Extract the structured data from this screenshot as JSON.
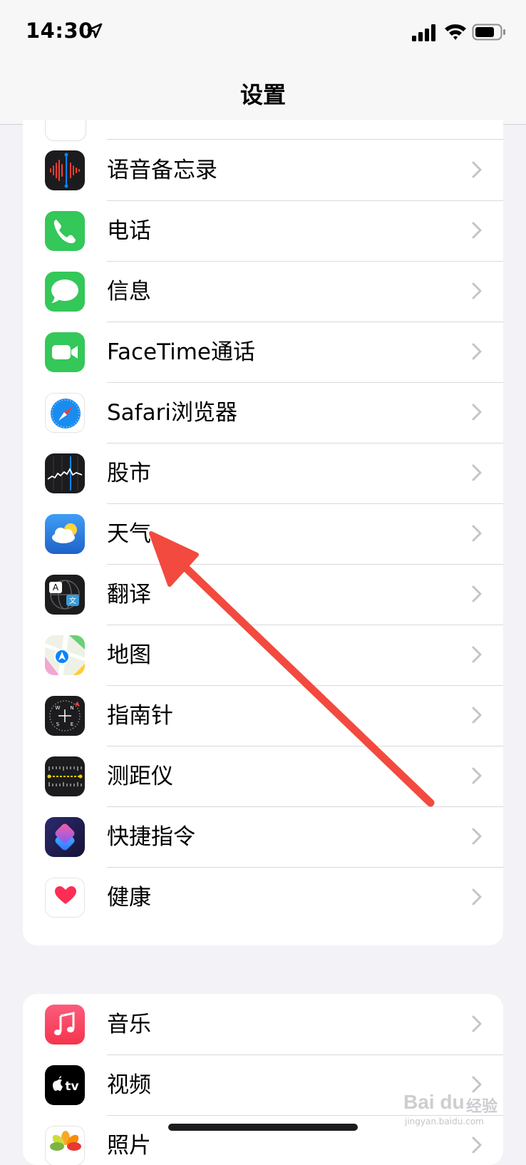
{
  "status_bar": {
    "time": "14:30",
    "icons": [
      "location-arrow-icon",
      "cellular-signal-icon",
      "wifi-icon",
      "battery-icon"
    ]
  },
  "nav": {
    "title": "设置"
  },
  "colors": {
    "background": "#f2f2f7",
    "cell": "#ffffff",
    "separator": "#d9d9de",
    "chevron": "#c4c4c7",
    "annotation_arrow": "#f24a3f"
  },
  "group_a": {
    "items": [
      {
        "label": "语音备忘录",
        "icon": "voice-memos-icon"
      },
      {
        "label": "电话",
        "icon": "phone-icon"
      },
      {
        "label": "信息",
        "icon": "messages-icon"
      },
      {
        "label": "FaceTime通话",
        "icon": "facetime-icon"
      },
      {
        "label": "Safari浏览器",
        "icon": "safari-icon"
      },
      {
        "label": "股市",
        "icon": "stocks-icon"
      },
      {
        "label": "天气",
        "icon": "weather-icon"
      },
      {
        "label": "翻译",
        "icon": "translate-icon"
      },
      {
        "label": "地图",
        "icon": "maps-icon"
      },
      {
        "label": "指南针",
        "icon": "compass-icon"
      },
      {
        "label": "测距仪",
        "icon": "measure-icon"
      },
      {
        "label": "快捷指令",
        "icon": "shortcuts-icon"
      },
      {
        "label": "健康",
        "icon": "health-icon"
      }
    ]
  },
  "group_b": {
    "items": [
      {
        "label": "音乐",
        "icon": "music-icon"
      },
      {
        "label": "视频",
        "icon": "apple-tv-icon"
      },
      {
        "label": "照片",
        "icon": "photos-icon"
      }
    ]
  },
  "annotation": {
    "type": "arrow",
    "points_to": "天气"
  },
  "watermark": {
    "brand": "Bai du",
    "cn": "经验",
    "url": "jingyan.baidu.com"
  }
}
